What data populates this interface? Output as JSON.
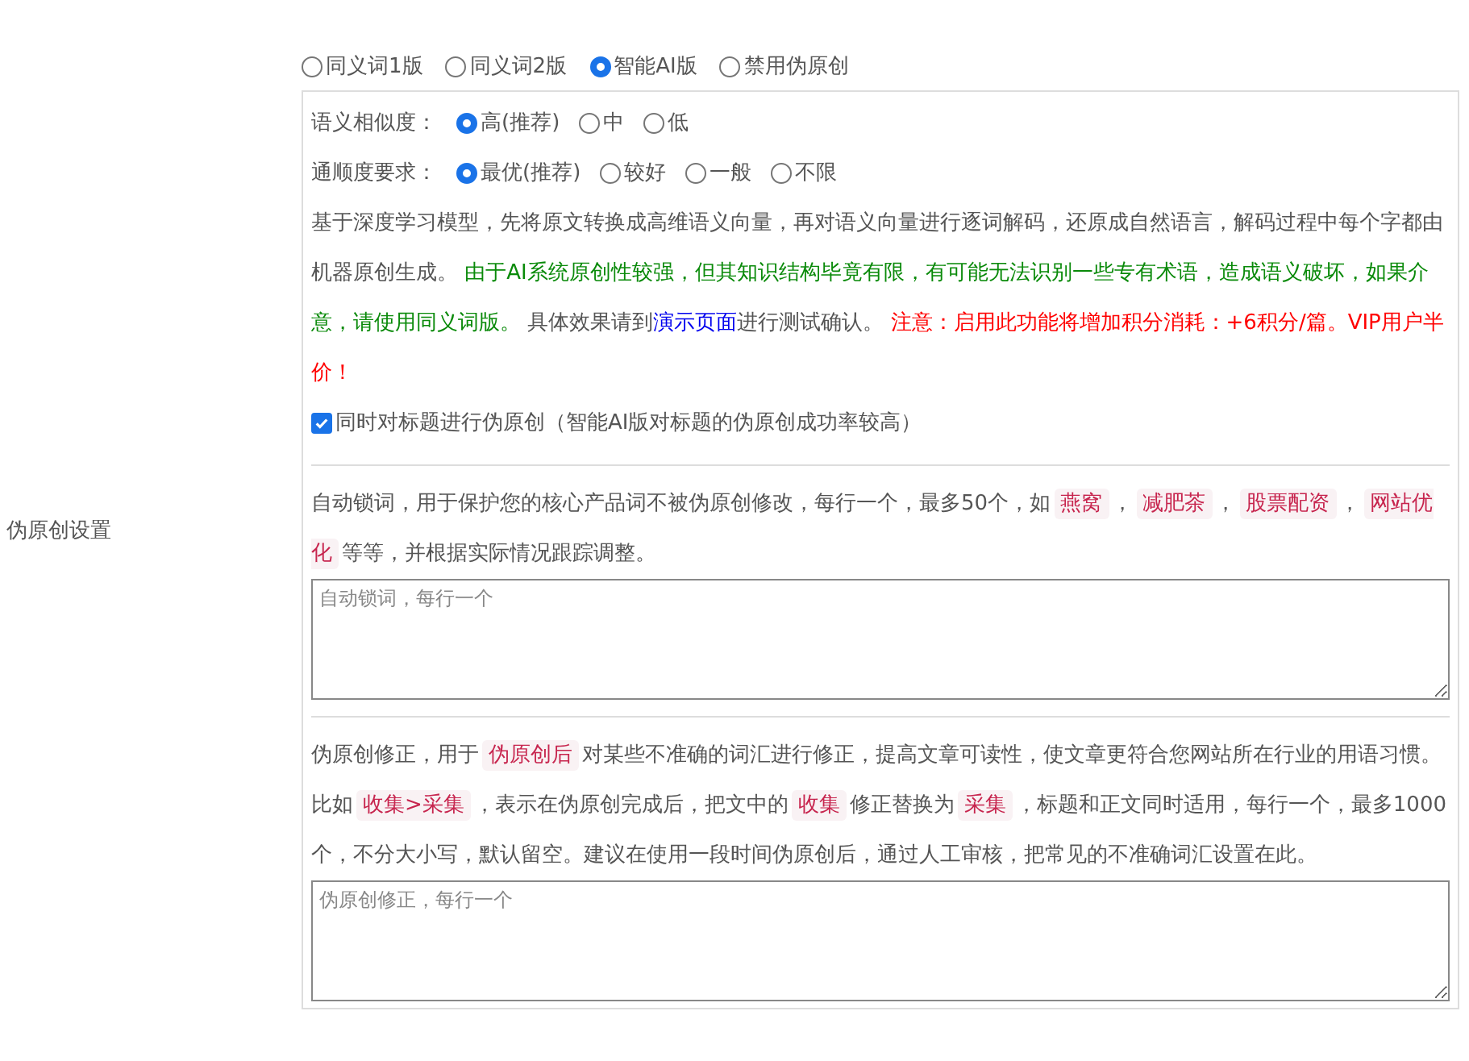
{
  "setting_label": "伪原创设置",
  "mode": {
    "options": [
      {
        "label": "同义词1版",
        "selected": false
      },
      {
        "label": "同义词2版",
        "selected": false
      },
      {
        "label": "智能AI版",
        "selected": true
      },
      {
        "label": "禁用伪原创",
        "selected": false
      }
    ]
  },
  "ai_panel": {
    "similarity": {
      "label": "语义相似度：",
      "options": [
        {
          "label": "高(推荐)",
          "selected": true
        },
        {
          "label": "中",
          "selected": false
        },
        {
          "label": "低",
          "selected": false
        }
      ]
    },
    "fluency": {
      "label": "通顺度要求：",
      "options": [
        {
          "label": "最优(推荐)",
          "selected": true
        },
        {
          "label": "较好",
          "selected": false
        },
        {
          "label": "一般",
          "selected": false
        },
        {
          "label": "不限",
          "selected": false
        }
      ]
    },
    "description": [
      {
        "kind": "text",
        "text": "基于深度学习模型，先将原文转换成高维语义向量，再对语义向量进行逐词解码，还原成自然语言，解码过程中每个字都由机器原创生成。 "
      },
      {
        "kind": "success",
        "text": "由于AI系统原创性较强，但其知识结构毕竟有限，有可能无法识别一些专有术语，造成语义破坏，如果介意，请使用同义词版。"
      },
      {
        "kind": "text",
        "text": " 具体效果请到"
      },
      {
        "kind": "link",
        "text": "演示页面"
      },
      {
        "kind": "text",
        "text": "进行测试确认。 "
      },
      {
        "kind": "warning",
        "text": "注意：启用此功能将增加积分消耗：+6积分/篇。VIP用户半价！"
      }
    ],
    "title_option": {
      "label": "同时对标题进行伪原创（智能AI版对标题的伪原创成功率较高）",
      "checked": true
    }
  },
  "lock_words": {
    "help": [
      {
        "kind": "text",
        "text": "自动锁词，用于保护您的核心产品词不被伪原创修改，每行一个，最多50个，如"
      },
      {
        "kind": "code",
        "text": "燕窝"
      },
      {
        "kind": "text",
        "text": "，"
      },
      {
        "kind": "code",
        "text": "减肥茶"
      },
      {
        "kind": "text",
        "text": "，"
      },
      {
        "kind": "code",
        "text": "股票配资"
      },
      {
        "kind": "text",
        "text": "，"
      },
      {
        "kind": "code",
        "text": "网站优化"
      },
      {
        "kind": "text",
        "text": "等等，并根据实际情况跟踪调整。"
      }
    ],
    "placeholder": "自动锁词，每行一个"
  },
  "corrections": {
    "help": [
      {
        "kind": "text",
        "text": "伪原创修正，用于"
      },
      {
        "kind": "code",
        "text": "伪原创后"
      },
      {
        "kind": "text",
        "text": "对某些不准确的词汇进行修正，提高文章可读性，使文章更符合您网站所在行业的用语习惯。比如"
      },
      {
        "kind": "code",
        "text": "收集>采集"
      },
      {
        "kind": "text",
        "text": "，表示在伪原创完成后，把文中的"
      },
      {
        "kind": "code",
        "text": "收集"
      },
      {
        "kind": "text",
        "text": "修正替换为"
      },
      {
        "kind": "code",
        "text": "采集"
      },
      {
        "kind": "text",
        "text": "，标题和正文同时适用，每行一个，最多1000个，不分大小写，默认留空。建议在使用一段时间伪原创后，通过人工审核，把常见的不准确词汇设置在此。"
      }
    ],
    "placeholder": "伪原创修正，每行一个"
  }
}
